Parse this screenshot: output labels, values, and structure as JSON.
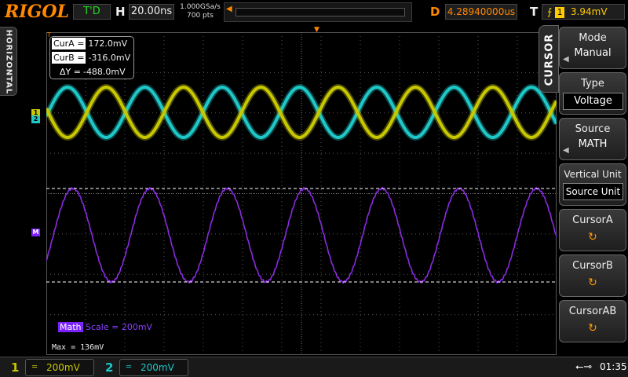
{
  "brand": "RIGOL",
  "top": {
    "run_status": "T'D",
    "h_label": "H",
    "timebase": "20.00ns",
    "sample_rate": "1.000GSa/s",
    "mem_depth": "700  pts",
    "d_label": "D",
    "delay": "4.28940000us",
    "t_label": "T",
    "trigger_source": "1",
    "trigger_level": "3.94mV"
  },
  "left_tab": "HORIZONTAL",
  "cursor_box": {
    "cura_label": "CurA =",
    "cura_value": "172.0mV",
    "curb_label": "CurB =",
    "curb_value": "-316.0mV",
    "dy_label": "ΔY =",
    "dy_value": "-488.0mV"
  },
  "channel_markers": {
    "ch1": "1",
    "ch2": "2",
    "math": "M"
  },
  "math_label": {
    "tag": "Math",
    "text": "Scale = 200mV"
  },
  "max_label": "Max = 136mV",
  "menu": {
    "tab_label": "CURSOR",
    "items": [
      {
        "title": "Mode",
        "value": "Manual"
      },
      {
        "title": "Type",
        "value": "Voltage"
      },
      {
        "title": "Source",
        "value": "MATH"
      },
      {
        "title": "Vertical Unit",
        "value": "Source Unit"
      },
      {
        "title": "CursorA",
        "value": ""
      },
      {
        "title": "CursorB",
        "value": ""
      },
      {
        "title": "CursorAB",
        "value": ""
      }
    ]
  },
  "bottom": {
    "ch1": {
      "num": "1",
      "coupling": "═",
      "scale": "200mV"
    },
    "ch2": {
      "num": "2",
      "coupling": "═",
      "scale": "200mV"
    },
    "usb_icon": "usb-icon",
    "time": "01:35"
  },
  "colors": {
    "ch1": "#c8c800",
    "ch2": "#1ec8c8",
    "math": "#8a2be2",
    "accent": "#ff8800"
  }
}
